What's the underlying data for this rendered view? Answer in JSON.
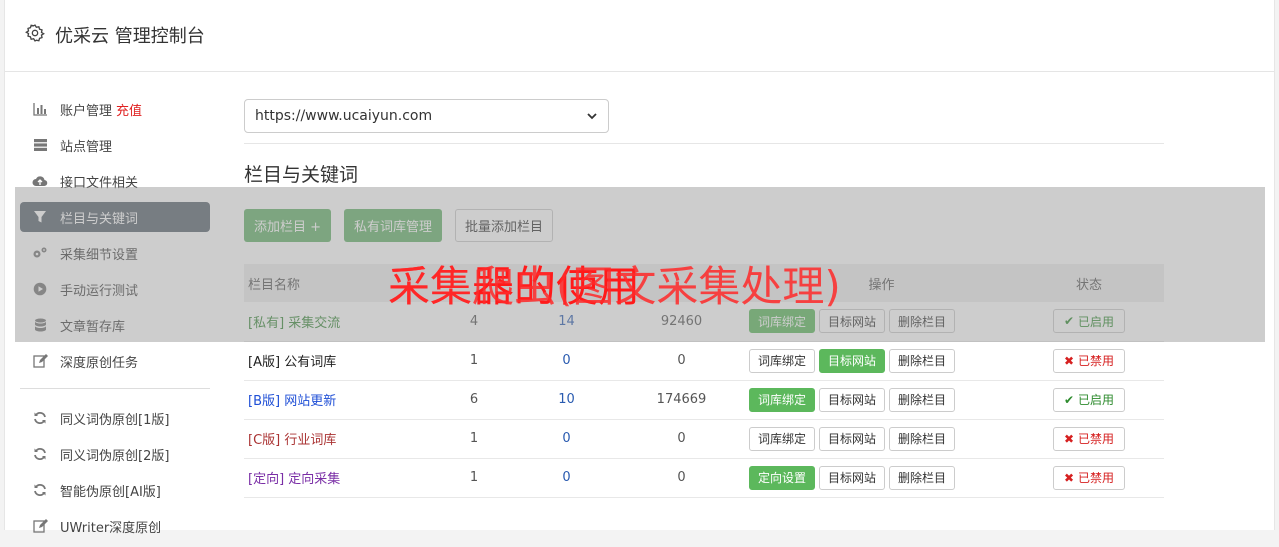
{
  "header": {
    "title": "优采云 管理控制台",
    "icon": "gear-icon"
  },
  "sidebar": {
    "items": [
      {
        "label": "账户管理",
        "extra": "充值",
        "icon": "bar-chart-icon"
      },
      {
        "label": "站点管理",
        "icon": "server-icon"
      },
      {
        "label": "接口文件相关",
        "icon": "cloud-upload-icon"
      },
      {
        "label": "栏目与关键词",
        "icon": "filter-icon",
        "active": true
      },
      {
        "label": "采集细节设置",
        "icon": "cogs-icon"
      },
      {
        "label": "手动运行测试",
        "icon": "play-circle-icon"
      },
      {
        "label": "文章暂存库",
        "icon": "database-icon"
      },
      {
        "label": "深度原创任务",
        "icon": "edit-icon"
      }
    ],
    "items2": [
      {
        "label": "同义词伪原创[1版]",
        "icon": "refresh-icon"
      },
      {
        "label": "同义词伪原创[2版]",
        "icon": "refresh-icon"
      },
      {
        "label": "智能伪原创[AI版]",
        "icon": "refresh-icon"
      },
      {
        "label": "UWriter深度原创",
        "icon": "edit-icon"
      }
    ]
  },
  "main": {
    "site_select": "https://www.ucaiyun.com",
    "section_title": "栏目与关键词",
    "buttons": {
      "add": "添加栏目 +",
      "private_lib": "私有词库管理",
      "batch_add": "批量添加栏目"
    },
    "table": {
      "headers": [
        "栏目名称",
        "",
        "",
        "",
        "操作",
        "状态"
      ],
      "rows": [
        {
          "tag": "[私有]",
          "name": "采集交流",
          "a": "4",
          "b": "14",
          "c": "92460",
          "op1": "词库绑定",
          "op2": "目标网站",
          "op3": "删除栏目",
          "status": "已启用"
        },
        {
          "tag": "[A版]",
          "name": "公有词库",
          "a": "1",
          "b": "0",
          "c": "0",
          "op1": "词库绑定",
          "op2": "目标网站",
          "op3": "删除栏目",
          "status": "已禁用"
        },
        {
          "tag": "[B版]",
          "name": "网站更新",
          "a": "6",
          "b": "10",
          "c": "174669",
          "op1": "词库绑定",
          "op2": "目标网站",
          "op3": "删除栏目",
          "status": "已启用"
        },
        {
          "tag": "[C版]",
          "name": "行业词库",
          "a": "1",
          "b": "0",
          "c": "0",
          "op1": "词库绑定",
          "op2": "目标网站",
          "op3": "删除栏目",
          "status": "已禁用"
        },
        {
          "tag": "[定向]",
          "name": "定向采集",
          "a": "1",
          "b": "0",
          "c": "0",
          "op1": "定向设置",
          "op2": "目标网站",
          "op3": "删除栏目",
          "status": "已禁用"
        }
      ]
    }
  },
  "overlay": {
    "text1": "采集器的使用",
    "text2": "采集爬虫(图文采集处理)"
  },
  "colors": {
    "accent_green": "#5cb85c",
    "active_nav": "#5b6670",
    "overlay_text": "#ff1a1a"
  }
}
